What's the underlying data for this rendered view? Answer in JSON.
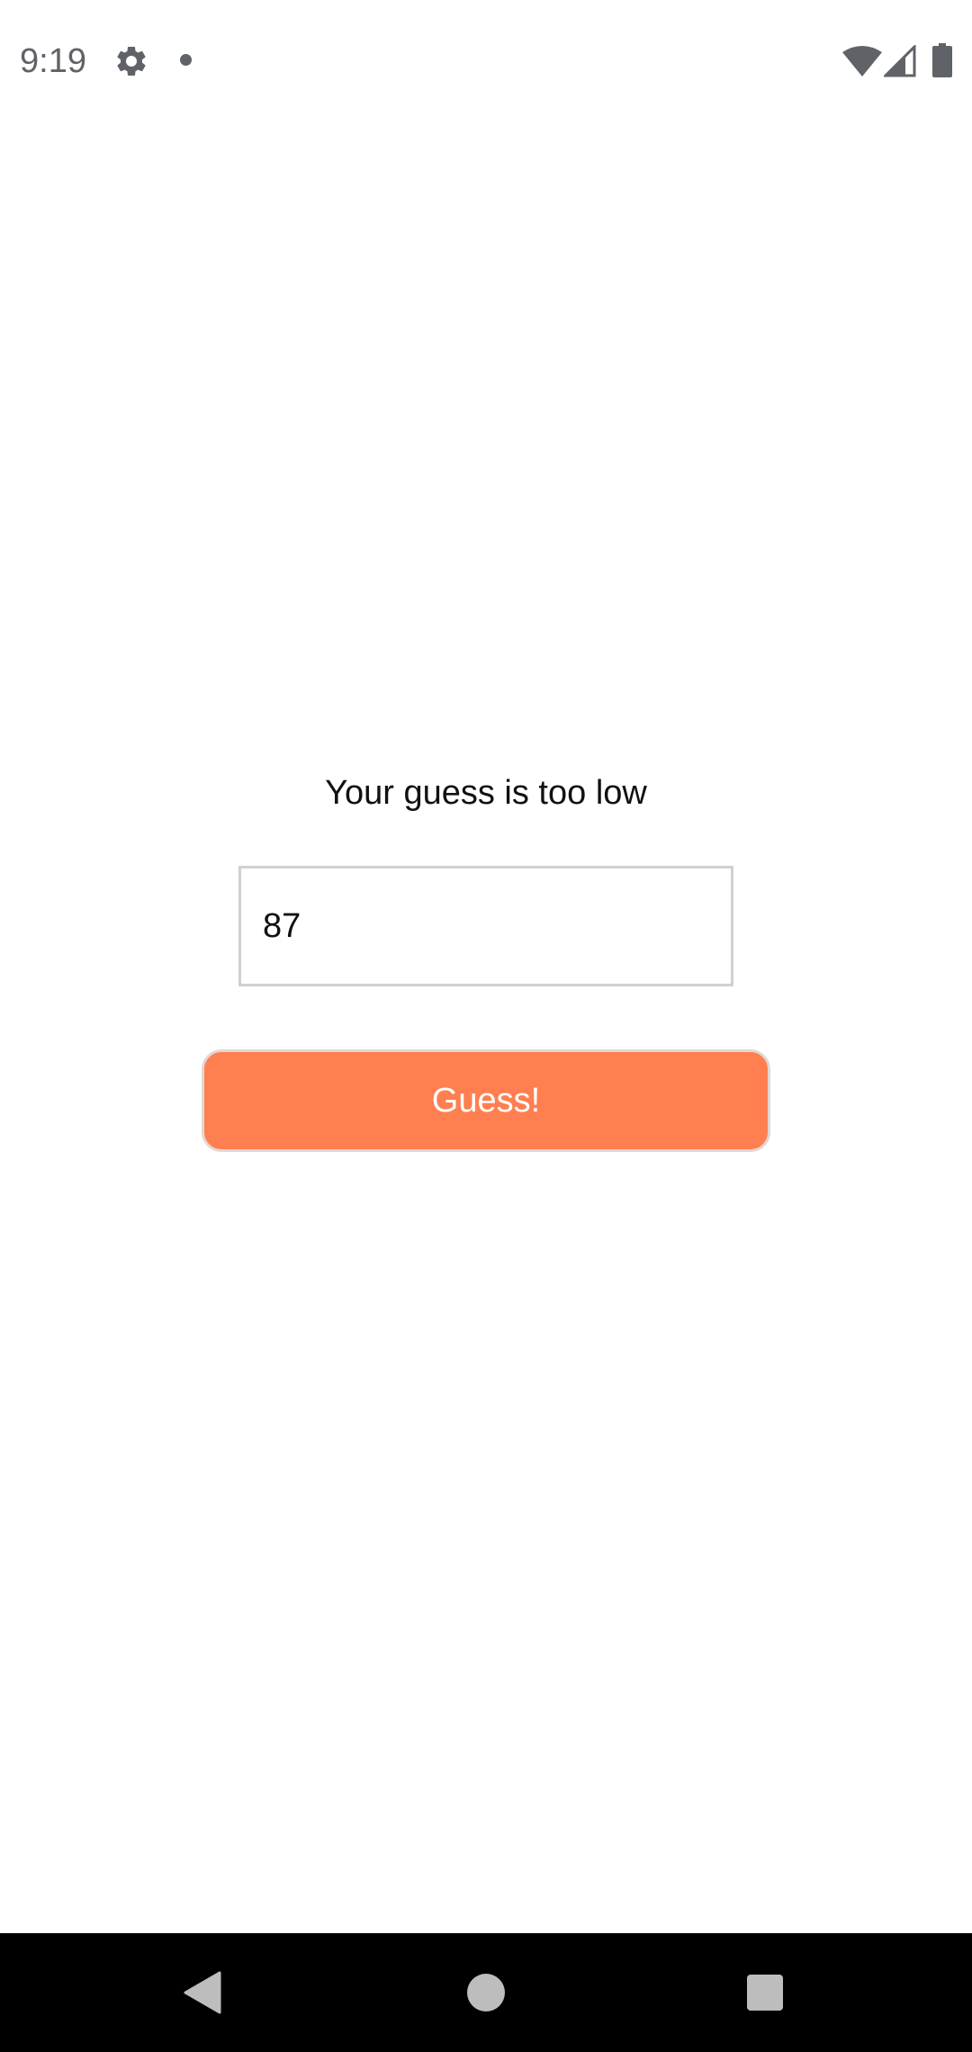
{
  "status_bar": {
    "time": "9:19",
    "icons": [
      "gear-icon",
      "notification-dot-icon",
      "wifi-icon",
      "signal-icon",
      "battery-icon"
    ]
  },
  "game": {
    "message": "Your guess is too low",
    "input_value": "87",
    "button_label": "Guess!"
  },
  "colors": {
    "button_background": "#ff7f50",
    "button_text": "#ffffff",
    "nav_bar_background": "#000000"
  },
  "nav_bar": {
    "icons": [
      "back-icon",
      "home-icon",
      "recents-icon"
    ]
  }
}
